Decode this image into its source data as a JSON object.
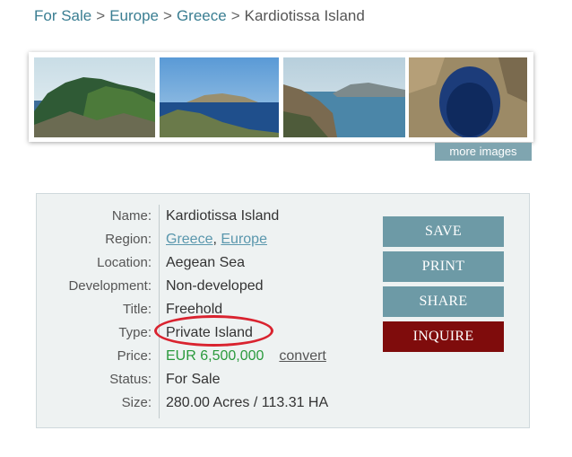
{
  "breadcrumb": {
    "items": [
      "For Sale",
      "Europe",
      "Greece"
    ],
    "separator": ">",
    "current": "Kardiotissa Island"
  },
  "gallery": {
    "thumbnails": [
      "island-coast-image",
      "island-sea-image",
      "cliff-coast-image",
      "sea-cave-image"
    ],
    "more_label": "more images"
  },
  "details": {
    "labels": {
      "name": "Name:",
      "region": "Region:",
      "location": "Location:",
      "development": "Development:",
      "title": "Title:",
      "type": "Type:",
      "price": "Price:",
      "status": "Status:",
      "size": "Size:"
    },
    "values": {
      "name": "Kardiotissa Island",
      "region_country": "Greece",
      "region_sep": ",",
      "region_continent": "Europe",
      "location": "Aegean Sea",
      "development": "Non-developed",
      "title": "Freehold",
      "type": "Private Island",
      "price": "EUR 6,500,000",
      "convert": "convert",
      "status": "For Sale",
      "size": "280.00 Acres / 113.31 HA"
    }
  },
  "actions": {
    "save": "SAVE",
    "print": "PRINT",
    "share": "SHARE",
    "inquire": "INQUIRE"
  },
  "colors": {
    "link": "#3a7e92",
    "button_blue": "#6d9aa6",
    "button_red": "#7f0c0c",
    "price_green": "#2a9a3c",
    "highlight_red": "#d9232f"
  }
}
